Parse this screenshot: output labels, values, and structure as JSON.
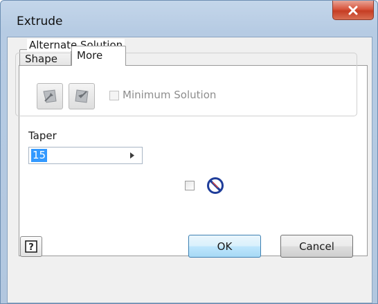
{
  "window": {
    "title": "Extrude",
    "close_label": "X"
  },
  "tabs": [
    {
      "label": "Shape",
      "active": false
    },
    {
      "label": "More",
      "active": true
    }
  ],
  "alternate_solution": {
    "group_label": "Alternate Solution",
    "minimum_solution_label": "Minimum Solution",
    "minimum_solution_checked": false,
    "minimum_solution_enabled": false
  },
  "taper": {
    "label": "Taper",
    "value": "15",
    "checkbox_checked": false
  },
  "footer": {
    "help_label": "?",
    "ok_label": "OK",
    "cancel_label": "Cancel"
  },
  "colors": {
    "title_bar": "#b6cbe3",
    "close_button": "#c53e24",
    "selection": "#3399ff",
    "ok_button_border": "#3c7fb1",
    "flip_icon": "#1f3d9a"
  },
  "icons": {
    "close": "close-icon",
    "flip_direction": "flip-direction-icon",
    "help": "help-icon"
  }
}
